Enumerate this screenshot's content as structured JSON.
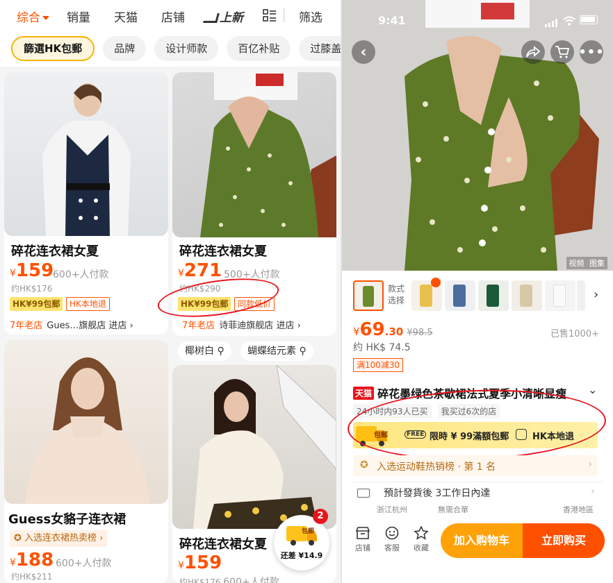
{
  "left": {
    "sort_bar": [
      "综合",
      "销量",
      "天猫",
      "店铺",
      "上新",
      "筛选"
    ],
    "chips": [
      "篩選HK包郵",
      "品牌",
      "设计师款",
      "百亿补贴",
      "过膝盖"
    ],
    "currency": "¥",
    "enter_store": "进店",
    "cards": [
      {
        "title": "碎花连衣裙女夏",
        "price": "159",
        "paid": "600+人付款",
        "hk": "约HK$176",
        "tag1": "HK¥99包郵",
        "tag2": "HK本地退",
        "shop_age": "7年老店",
        "shop": "Gues…旗舰店"
      },
      {
        "title": "碎花连衣裙女夏",
        "price": "271",
        "paid": "500+人付款",
        "hk": "约HK$290",
        "tag1": "HK¥99包郵",
        "tag2": "同款低价",
        "shop_age": "7年老店",
        "shop": "诗菲迪旗舰店"
      },
      {
        "title": "Guess女貉子连衣裙",
        "rank": "入选连衣裙热卖榜",
        "price": "188",
        "paid": "600+人付款",
        "hk": "约HK$211"
      },
      {
        "title": "碎花连衣裙女夏",
        "price": "159",
        "hk": "约HK$176",
        "paid": "600+人付款"
      }
    ],
    "keywords": [
      "椰树白",
      "蝴蝶结元素"
    ],
    "float_cart": {
      "icon_label": "包郵",
      "label": "还差 ¥14.9",
      "badge": "2"
    }
  },
  "right": {
    "status": {
      "time": "9:41"
    },
    "media_tabs": [
      "视频",
      "图集"
    ],
    "style_label": "款式选择",
    "currency": "¥",
    "price_int": "69",
    "price_dec": ".30",
    "orig_price": "¥98.5",
    "sold": "已售1000+",
    "hk_price": "约 HK$ 74.5",
    "promo": "满100减30",
    "tmall_badge": "天猫",
    "title": "碎花墨绿色茶歇裙法式夏季小清晰显瘦",
    "buyers_tag": "24小时内93人已买",
    "repeat_tag": "我买过6次的店",
    "banner": {
      "icon_label": "包郵",
      "free_ship": "限時 ¥ 99滿額包郵",
      "local_return": "HK本地退"
    },
    "ranking": "入选运动鞋热销榜 · 第 1 名",
    "delivery": {
      "estimate": "預計發貨後 3工作日內達",
      "from": "浙江杭州",
      "note": "無需合單",
      "to": "香港地區"
    },
    "bottom": {
      "store": "店铺",
      "service": "客服",
      "favorite": "收藏",
      "add_cart": "加入购物车",
      "buy_now": "立即购买"
    }
  }
}
